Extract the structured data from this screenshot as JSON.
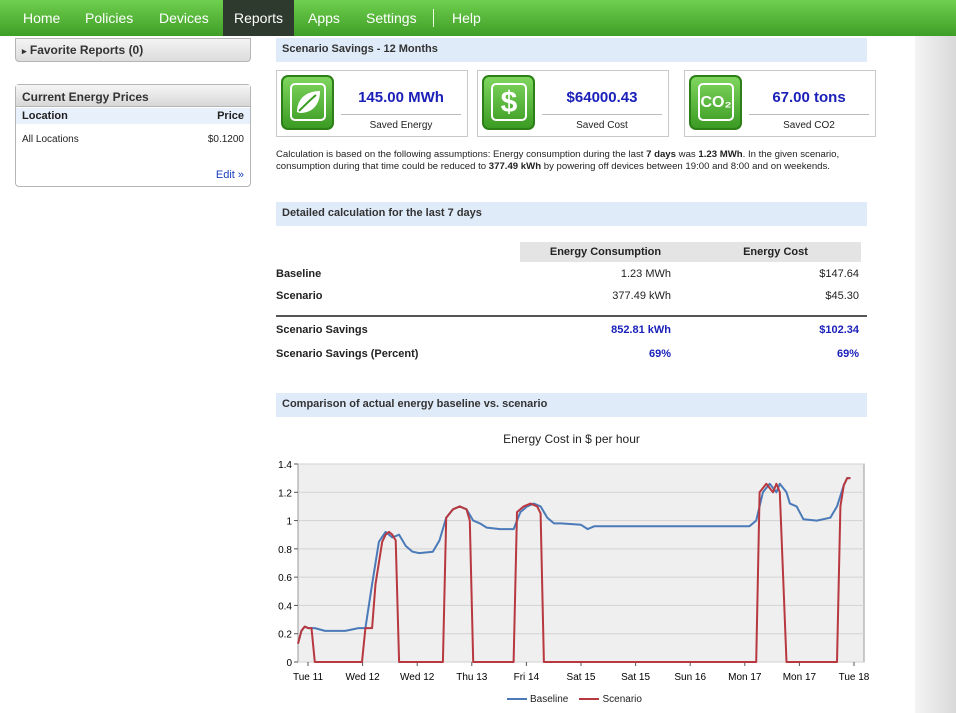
{
  "nav": {
    "items": [
      {
        "label": "Home",
        "active": false
      },
      {
        "label": "Policies",
        "active": false
      },
      {
        "label": "Devices",
        "active": false
      },
      {
        "label": "Reports",
        "active": true
      },
      {
        "label": "Apps",
        "active": false
      },
      {
        "label": "Settings",
        "active": false
      },
      {
        "label": "Help",
        "active": false
      }
    ]
  },
  "sidebar": {
    "favorites": "Favorite Reports (0)",
    "prices_title": "Current Energy Prices",
    "col_location": "Location",
    "col_price": "Price",
    "rows": [
      {
        "location": "All Locations",
        "price": "$0.1200"
      }
    ],
    "edit": "Edit »"
  },
  "main": {
    "savings_header": "Scenario Savings - 12 Months",
    "cards": [
      {
        "icon": "leaf-icon",
        "value": "145.00 MWh",
        "label": "Saved Energy"
      },
      {
        "icon": "dollar-icon",
        "value": "$64000.43",
        "label": "Saved Cost"
      },
      {
        "icon": "co2-icon",
        "value": "67.00 tons",
        "label": "Saved CO2"
      }
    ],
    "co2_icon_text": "CO₂",
    "assumption": {
      "p1": "Calculation is based on the following assumptions: Energy consumption during the last ",
      "b1": "7 days",
      "p2": " was ",
      "b2": "1.23 MWh",
      "p3": ". In the given scenario, consumption during that time could be reduced to ",
      "b3": "377.49 kWh",
      "p4": " by powering off devices between 19:00 and 8:00 and on weekends."
    },
    "detail_header": "Detailed calculation for the last 7 days",
    "table": {
      "col1": "Energy Consumption",
      "col2": "Energy Cost",
      "rows": [
        {
          "label": "Baseline",
          "c1": "1.23 MWh",
          "c2": "$147.64"
        },
        {
          "label": "Scenario",
          "c1": "377.49 kWh",
          "c2": "$45.30"
        },
        {
          "label": "Scenario Savings",
          "c1": "852.81 kWh",
          "c2": "$102.34"
        },
        {
          "label": "Scenario Savings (Percent)",
          "c1": "69%",
          "c2": "69%"
        }
      ]
    },
    "comparison_header": "Comparison of actual energy baseline vs. scenario"
  },
  "chart_data": {
    "type": "line",
    "title": "Energy Cost in $ per hour",
    "ylim": [
      0,
      1.4
    ],
    "yticks": [
      "1.4",
      "1.2",
      "1",
      "0.8",
      "0.6",
      "0.4",
      "0.2",
      "0"
    ],
    "xticks": [
      "Tue 11",
      "Wed 12",
      "Wed 12",
      "Thu 13",
      "Fri 14",
      "Sat 15",
      "Sat 15",
      "Sun 16",
      "Mon 17",
      "Mon 17",
      "Tue 18"
    ],
    "x_range": [
      0,
      168
    ],
    "grid": true,
    "legend_position": "bottom",
    "series": [
      {
        "name": "Baseline",
        "color": "#4a7ab8",
        "points": [
          [
            0,
            0.13
          ],
          [
            1,
            0.22
          ],
          [
            2,
            0.25
          ],
          [
            3,
            0.24
          ],
          [
            5,
            0.24
          ],
          [
            8,
            0.22
          ],
          [
            14,
            0.22
          ],
          [
            18,
            0.24
          ],
          [
            20,
            0.24
          ],
          [
            22,
            0.55
          ],
          [
            24,
            0.85
          ],
          [
            26,
            0.92
          ],
          [
            28,
            0.88
          ],
          [
            30,
            0.9
          ],
          [
            32,
            0.82
          ],
          [
            34,
            0.78
          ],
          [
            36,
            0.77
          ],
          [
            40,
            0.78
          ],
          [
            42,
            0.86
          ],
          [
            44,
            1.02
          ],
          [
            46,
            1.08
          ],
          [
            48,
            1.1
          ],
          [
            50,
            1.08
          ],
          [
            52,
            1.0
          ],
          [
            54,
            0.98
          ],
          [
            56,
            0.95
          ],
          [
            60,
            0.94
          ],
          [
            64,
            0.94
          ],
          [
            66,
            1.06
          ],
          [
            68,
            1.1
          ],
          [
            70,
            1.12
          ],
          [
            72,
            1.1
          ],
          [
            74,
            1.02
          ],
          [
            76,
            0.98
          ],
          [
            78,
            0.98
          ],
          [
            84,
            0.97
          ],
          [
            86,
            0.94
          ],
          [
            88,
            0.96
          ],
          [
            96,
            0.96
          ],
          [
            100,
            0.96
          ],
          [
            110,
            0.96
          ],
          [
            120,
            0.96
          ],
          [
            130,
            0.96
          ],
          [
            134,
            0.96
          ],
          [
            136,
            1.0
          ],
          [
            138,
            1.2
          ],
          [
            140,
            1.26
          ],
          [
            142,
            1.2
          ],
          [
            143,
            1.26
          ],
          [
            145,
            1.2
          ],
          [
            146,
            1.12
          ],
          [
            148,
            1.1
          ],
          [
            150,
            1.01
          ],
          [
            154,
            1.0
          ],
          [
            158,
            1.02
          ],
          [
            160,
            1.1
          ],
          [
            162,
            1.25
          ],
          [
            163,
            1.3
          ],
          [
            164,
            1.3
          ]
        ]
      },
      {
        "name": "Scenario",
        "color": "#b8383f",
        "points": [
          [
            0,
            0.13
          ],
          [
            1,
            0.22
          ],
          [
            2,
            0.25
          ],
          [
            3,
            0.24
          ],
          [
            4,
            0.24
          ],
          [
            5,
            0.0
          ],
          [
            19,
            0.0
          ],
          [
            20,
            0.24
          ],
          [
            22,
            0.24
          ],
          [
            23,
            0.55
          ],
          [
            25,
            0.85
          ],
          [
            26,
            0.9
          ],
          [
            27,
            0.92
          ],
          [
            28,
            0.9
          ],
          [
            29,
            0.86
          ],
          [
            30,
            0.0
          ],
          [
            43,
            0.0
          ],
          [
            44,
            1.02
          ],
          [
            46,
            1.08
          ],
          [
            48,
            1.1
          ],
          [
            50,
            1.08
          ],
          [
            51,
            1.0
          ],
          [
            52,
            0.0
          ],
          [
            64,
            0.0
          ],
          [
            65,
            1.06
          ],
          [
            67,
            1.1
          ],
          [
            69,
            1.12
          ],
          [
            71,
            1.1
          ],
          [
            72,
            1.05
          ],
          [
            73,
            0.0
          ],
          [
            136,
            0.0
          ],
          [
            137,
            1.2
          ],
          [
            139,
            1.26
          ],
          [
            141,
            1.2
          ],
          [
            142,
            1.26
          ],
          [
            143,
            1.2
          ],
          [
            145,
            0.0
          ],
          [
            160,
            0.0
          ],
          [
            161,
            1.1
          ],
          [
            162,
            1.25
          ],
          [
            163,
            1.3
          ],
          [
            164,
            1.3
          ]
        ]
      }
    ]
  }
}
